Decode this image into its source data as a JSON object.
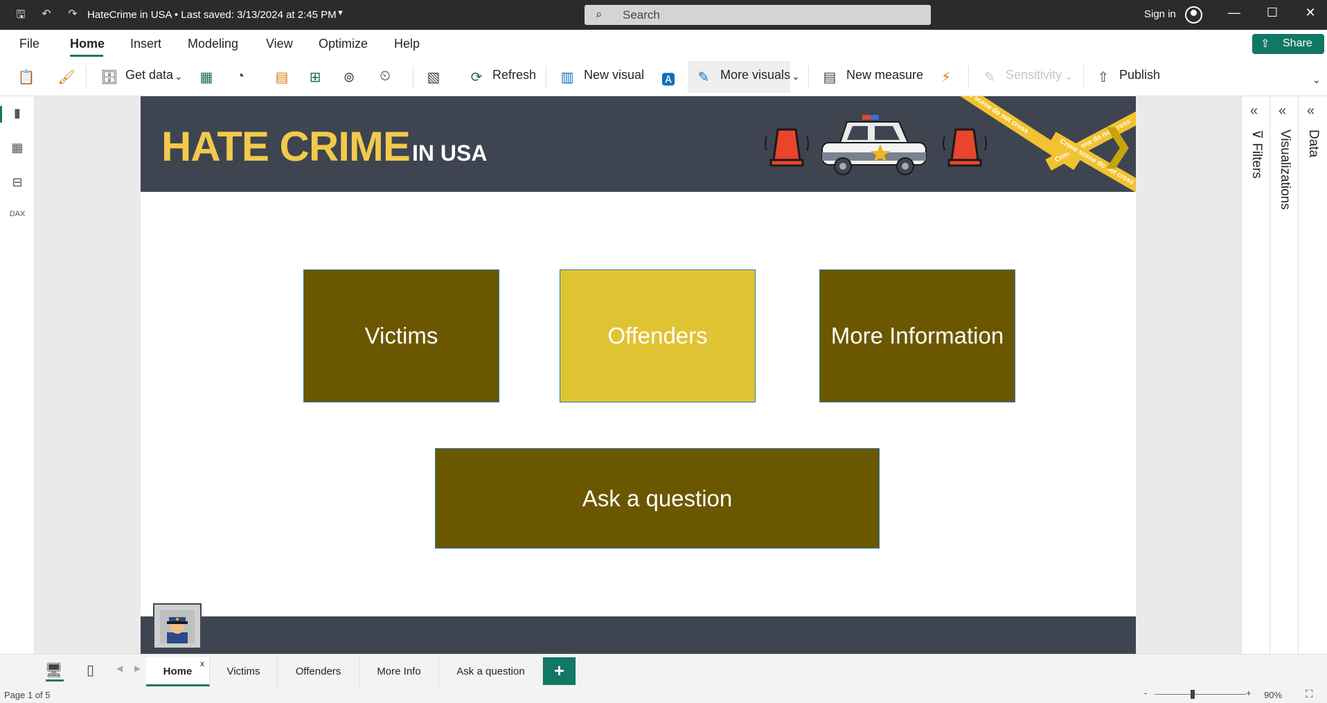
{
  "titlebar": {
    "title": "HateCrime in USA • Last saved: 3/13/2024 at 2:45 PM",
    "search_placeholder": "Search",
    "signin": "Sign in"
  },
  "menubar": {
    "items": [
      "File",
      "Home",
      "Insert",
      "Modeling",
      "View",
      "Optimize",
      "Help"
    ],
    "share": "Share"
  },
  "ribbon": {
    "get_data": "Get data",
    "refresh": "Refresh",
    "new_visual": "New visual",
    "more_visuals": "More visuals",
    "new_measure": "New measure",
    "sensitivity": "Sensitivity",
    "publish": "Publish"
  },
  "report": {
    "title": "HATE CRIME",
    "subtitle": "IN USA",
    "tape_text": "Crime scene do not cross",
    "buttons": {
      "victims": "Victims",
      "offenders": "Offenders",
      "more_info": "More Information",
      "ask": "Ask a question"
    },
    "colors": {
      "header": "#3e4550",
      "accent": "#f2c94c",
      "button_dark": "#6b5700",
      "button_light": "#e0c332"
    }
  },
  "panes": {
    "filters": "Filters",
    "visualizations": "Visualizations",
    "data": "Data"
  },
  "tabs": [
    "Home",
    "Victims",
    "Offenders",
    "More Info",
    "Ask a question"
  ],
  "tab_close": "x",
  "status": {
    "page": "Page 1 of 5",
    "zoom": "90%"
  }
}
